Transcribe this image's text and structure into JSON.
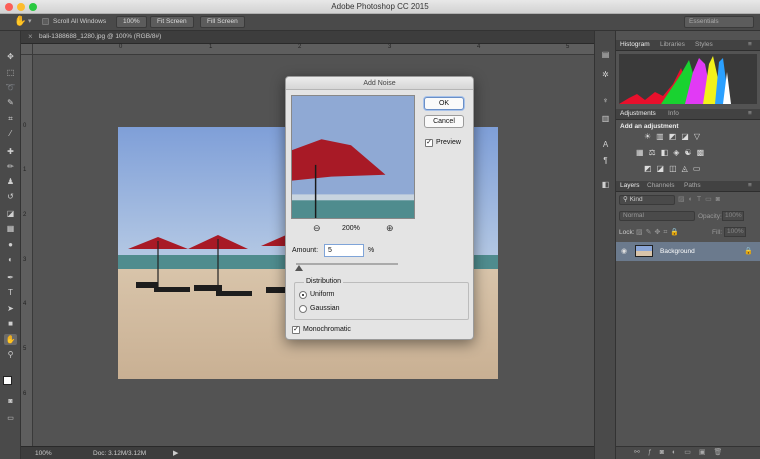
{
  "app": {
    "title": "Adobe Photoshop CC 2015"
  },
  "options_bar": {
    "scroll_all_windows": "Scroll All Windows",
    "btn_100": "100%",
    "btn_fit": "Fit Screen",
    "btn_fill": "Fill Screen",
    "workspace": "Essentials"
  },
  "document": {
    "tab_title": "bali-1388688_1280.jpg @ 100% (RGB/8#)",
    "ruler_labels": [
      "0",
      "1",
      "2",
      "3",
      "4",
      "5",
      "6",
      "7",
      "8"
    ]
  },
  "status": {
    "zoom": "100%",
    "doc_size": "Doc: 3.12M/3.12M"
  },
  "panels": {
    "top_tabs": [
      "Histogram",
      "Libraries",
      "Styles"
    ],
    "adjust_tabs": [
      "Adjustments",
      "Info"
    ],
    "adjust_heading": "Add an adjustment",
    "layer_tabs": [
      "Layers",
      "Channels",
      "Paths"
    ],
    "kind_label": "Kind",
    "blend_mode": "Normal",
    "opacity_label": "Opacity:",
    "opacity_value": "100%",
    "lock_label": "Lock:",
    "fill_label": "Fill:",
    "fill_value": "100%",
    "layer_name": "Background"
  },
  "dialog": {
    "title": "Add Noise",
    "ok": "OK",
    "cancel": "Cancel",
    "preview": "Preview",
    "zoom": "200%",
    "amount_label": "Amount:",
    "amount_value": "5",
    "amount_unit": "%",
    "distribution": "Distribution",
    "uniform": "Uniform",
    "gaussian": "Gaussian",
    "monochromatic": "Monochromatic"
  },
  "icons": {
    "tools": [
      "move-icon",
      "marquee-icon",
      "lasso-icon",
      "quick-select-icon",
      "crop-icon",
      "eyedropper-icon",
      "healing-icon",
      "brush-icon",
      "clone-stamp-icon",
      "history-brush-icon",
      "eraser-icon",
      "gradient-icon",
      "blur-icon",
      "dodge-icon",
      "pen-icon",
      "type-icon",
      "path-select-icon",
      "shape-icon",
      "hand-icon",
      "zoom-icon"
    ]
  },
  "colors": {
    "accent": "#5b85c4",
    "panel": "#535353",
    "dialog": "#e4e4e4"
  }
}
